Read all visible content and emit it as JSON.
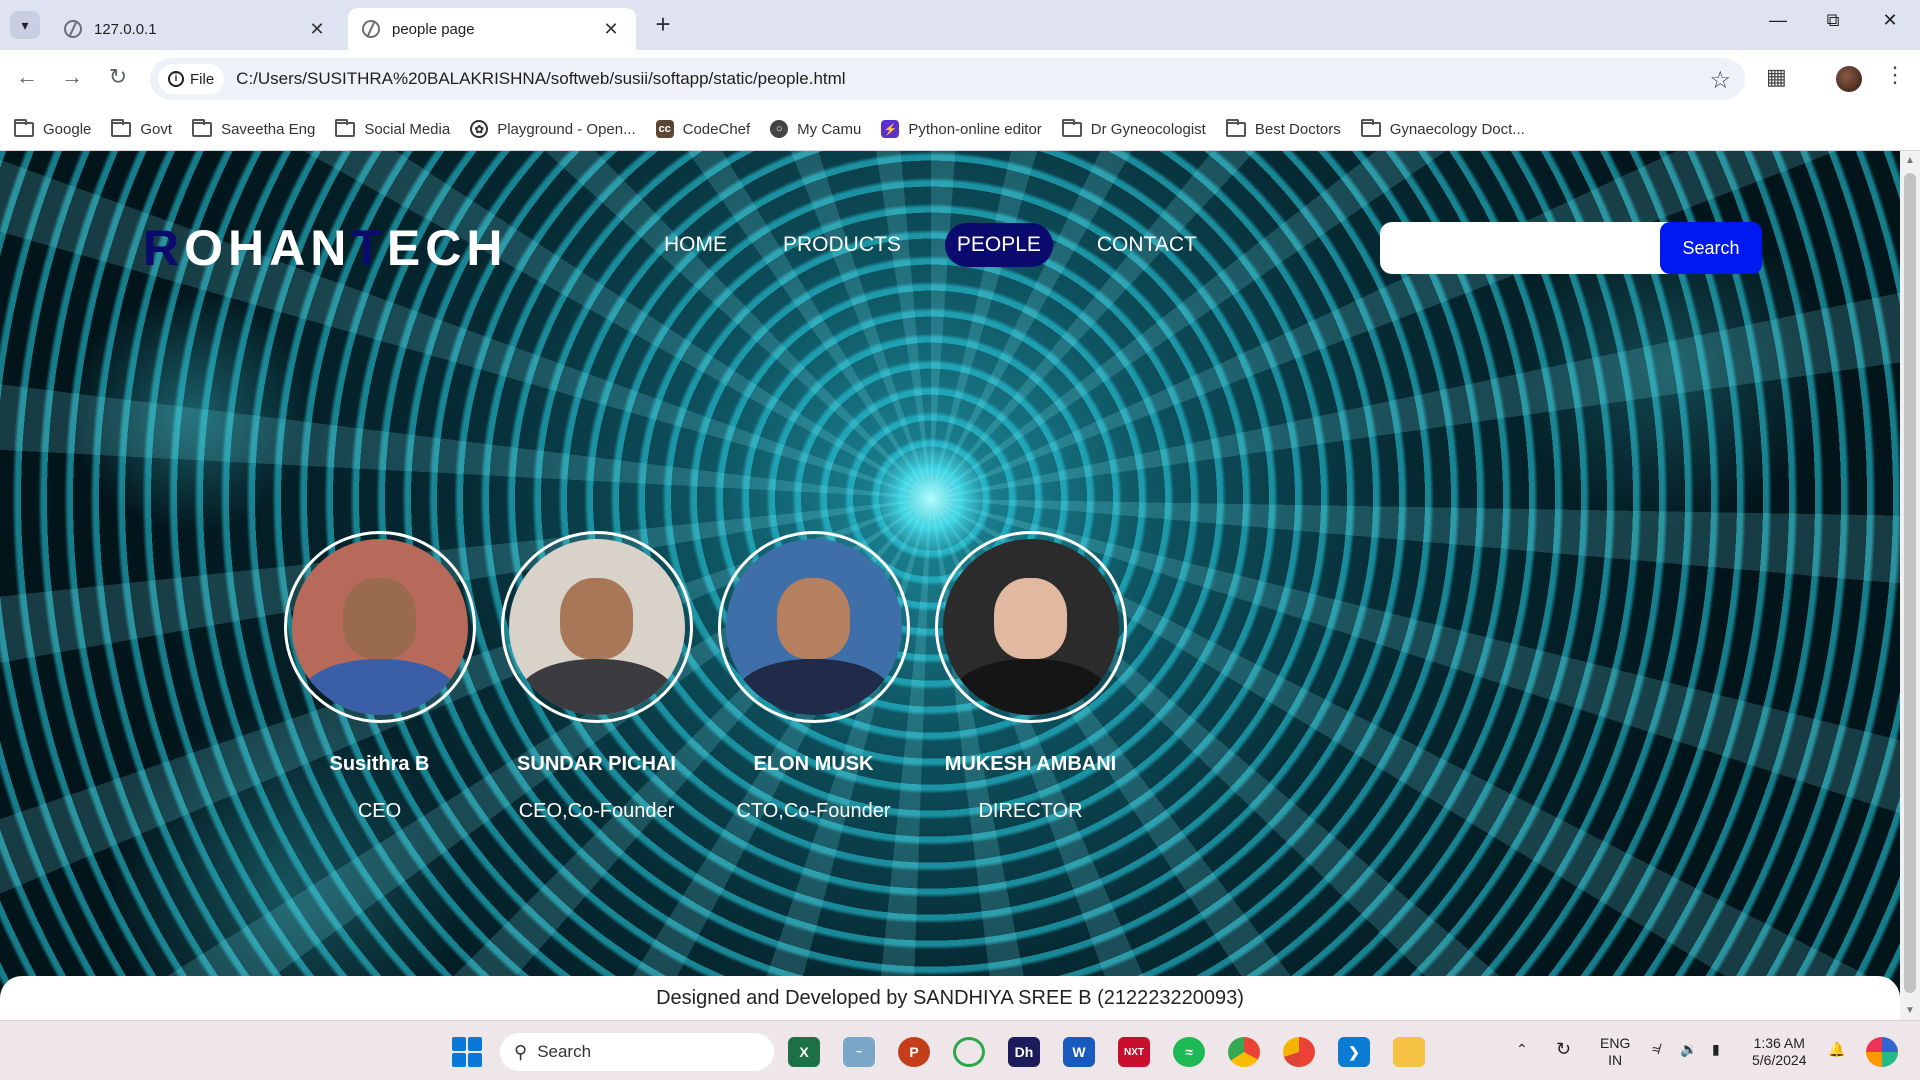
{
  "browser": {
    "tabs": [
      {
        "title": "127.0.0.1",
        "active": false
      },
      {
        "title": "people page",
        "active": true
      }
    ],
    "address": {
      "scheme_chip": "File",
      "url": "C:/Users/SUSITHRA%20BALAKRISHNA/softweb/susii/softapp/static/people.html"
    },
    "bookmarks": [
      {
        "label": "Google",
        "icon": "folder-icon"
      },
      {
        "label": "Govt",
        "icon": "folder-icon"
      },
      {
        "label": "Saveetha Eng",
        "icon": "folder-icon"
      },
      {
        "label": "Social Media",
        "icon": "folder-icon"
      },
      {
        "label": "Playground - Open...",
        "icon": "openai-icon"
      },
      {
        "label": "CodeChef",
        "icon": "codechef-icon"
      },
      {
        "label": "My Camu",
        "icon": "globe-icon"
      },
      {
        "label": "Python-online editor",
        "icon": "bolt-icon"
      },
      {
        "label": "Dr Gyneocologist",
        "icon": "folder-icon"
      },
      {
        "label": "Best Doctors",
        "icon": "folder-icon"
      },
      {
        "label": "Gynaecology Doct...",
        "icon": "folder-icon"
      }
    ]
  },
  "site": {
    "logo": {
      "first_letter": "R",
      "part1": "OHAN",
      "t_letter": "T",
      "part2": "ECH"
    },
    "nav": [
      {
        "label": "HOME",
        "active": false
      },
      {
        "label": "PRODUCTS",
        "active": false
      },
      {
        "label": "PEOPLE",
        "active": true
      },
      {
        "label": "CONTACT",
        "active": false
      }
    ],
    "search": {
      "value": "",
      "button_label": "Search"
    },
    "people": [
      {
        "name": "Susithra B",
        "role": "CEO",
        "bg": "#b86a5a",
        "skin": "#9a6a4e",
        "cloth": "#3a5fa6"
      },
      {
        "name": "SUNDAR PICHAI",
        "role": "CEO,Co-Founder",
        "bg": "#d9d2c8",
        "skin": "#a77758",
        "cloth": "#3b3b40"
      },
      {
        "name": "ELON MUSK",
        "role": "CTO,Co-Founder",
        "bg": "#3f6fa8",
        "skin": "#b58060",
        "cloth": "#1f2b48"
      },
      {
        "name": "MUKESH AMBANI",
        "role": "DIRECTOR",
        "bg": "#2b2b2b",
        "skin": "#e0b9a0",
        "cloth": "#151515"
      }
    ],
    "footer": "Designed and Developed by SANDHIYA SREE B (212223220093)",
    "colors": {
      "accent_navy": "#0b0a6e",
      "search_blue": "#0019f0"
    }
  },
  "taskbar": {
    "search_placeholder": "Search",
    "apps": [
      "excel-icon",
      "camu-icon",
      "powerpoint-icon",
      "edge-like-icon",
      "dh-icon",
      "word-icon",
      "sunnxt-icon",
      "spotify-icon",
      "chrome-icon",
      "chrome-alt-icon",
      "vscode-icon",
      "file-explorer-icon"
    ],
    "lang_top": "ENG",
    "lang_bottom": "IN",
    "time": "1:36 AM",
    "date": "5/6/2024"
  }
}
